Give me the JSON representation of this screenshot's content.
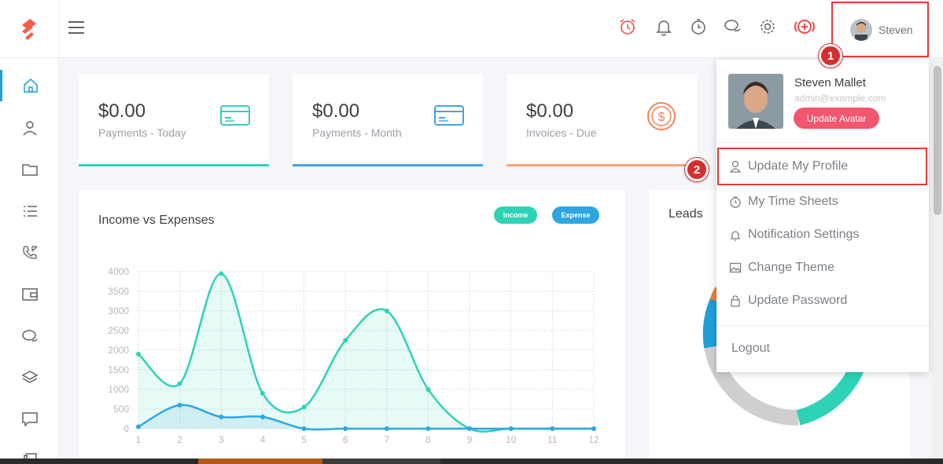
{
  "user": {
    "name": "Steven"
  },
  "stats": [
    {
      "amount": "$0.00",
      "label": "Payments - Today",
      "icon": "credit-card-icon",
      "color": "#2ed3b7"
    },
    {
      "amount": "$0.00",
      "label": "Payments - Month",
      "icon": "credit-card-icon",
      "color": "#42a5e0"
    },
    {
      "amount": "$0.00",
      "label": "Invoices - Due",
      "icon": "dollar-coin-icon",
      "color": "#f5a27a"
    }
  ],
  "chart_panel": {
    "title": "Income vs Expenses",
    "legend_income": "Income",
    "legend_expense": "Expense"
  },
  "leads_panel": {
    "title": "Leads"
  },
  "chart_data": {
    "type": "line",
    "title": "Income vs Expenses",
    "x": [
      1,
      2,
      3,
      4,
      5,
      6,
      7,
      8,
      9,
      10,
      11,
      12
    ],
    "ylim": [
      0,
      4000
    ],
    "yticks": [
      0,
      500,
      1000,
      1500,
      2000,
      2500,
      3000,
      3500,
      4000
    ],
    "grid": true,
    "legend": "top-right",
    "series": [
      {
        "name": "Income",
        "color": "#2ed3b7",
        "values": [
          1900,
          1150,
          3950,
          900,
          550,
          2250,
          3000,
          1000,
          0,
          0,
          0,
          0
        ]
      },
      {
        "name": "Expense",
        "color": "#2ea7e0",
        "values": [
          50,
          600,
          300,
          300,
          0,
          0,
          0,
          0,
          0,
          0,
          0,
          0
        ]
      }
    ]
  },
  "dropdown": {
    "name": "Steven Mallet",
    "email": "admin@example.com",
    "update_avatar": "Update Avatar",
    "items": [
      {
        "label": "Update My Profile",
        "icon": "user-icon"
      },
      {
        "label": "My Time Sheets",
        "icon": "timer-icon"
      },
      {
        "label": "Notification Settings",
        "icon": "bell-icon"
      },
      {
        "label": "Change Theme",
        "icon": "image-icon"
      },
      {
        "label": "Update Password",
        "icon": "lock-icon"
      }
    ],
    "logout": "Logout"
  },
  "markers": {
    "first": "1",
    "second": "2"
  },
  "colors": {
    "accent": "#1f9fd8",
    "brand": "#f35b4b",
    "highlight": "#e53935"
  }
}
